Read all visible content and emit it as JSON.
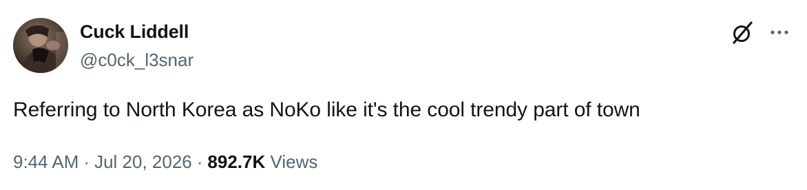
{
  "author": {
    "display_name": "Cuck Liddell",
    "handle": "@c0ck_l3snar",
    "avatar_icon": "profile-photo"
  },
  "header_actions": {
    "grok_icon": "slashed-circle-icon",
    "more_icon": "ellipsis-icon"
  },
  "tweet": {
    "text": "Referring to North Korea as NoKo like it's the cool trendy part of town"
  },
  "meta": {
    "time": "9:44 AM",
    "separator": "·",
    "date": "Jul 20, 2026",
    "views_count": "892.7K",
    "views_label": "Views"
  },
  "colors": {
    "text_primary": "#0f1419",
    "text_secondary": "#536471",
    "background": "#ffffff"
  }
}
